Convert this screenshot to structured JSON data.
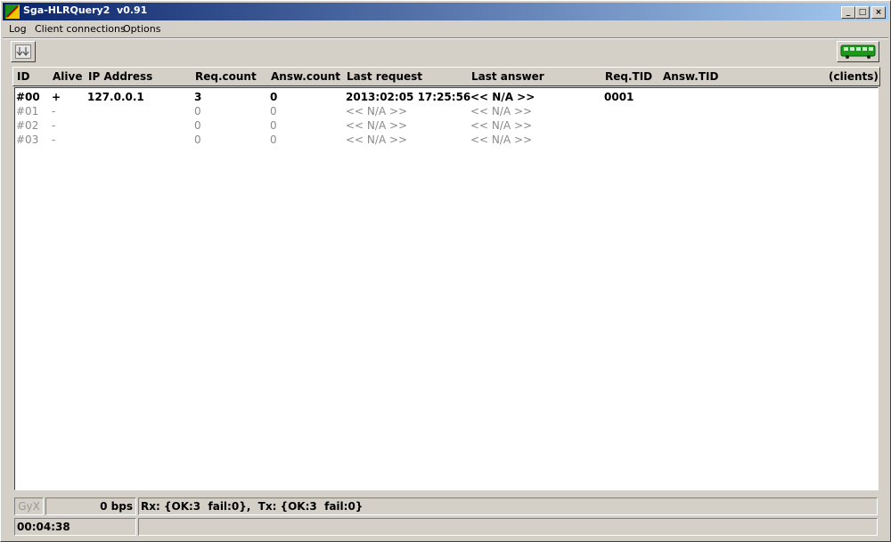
{
  "window": {
    "title": "Sga-HLRQuery2  v0.91"
  },
  "menu": [
    "Log",
    "Client connections",
    "Options"
  ],
  "columns": [
    "ID",
    "Alive",
    "IP Address",
    "Req.count",
    "Answ.count",
    "Last request",
    "Last answer",
    "Req.TID",
    "Answ.TID",
    "(clients)"
  ],
  "rows": [
    {
      "id": "#00",
      "alive": "+",
      "ip": "127.0.0.1",
      "req_count": "3",
      "answ_count": "0",
      "last_request": "2013:02:05 17:25:56",
      "last_answer": "<< N/A >>",
      "req_tid": "0001",
      "answ_tid": "",
      "active": true
    },
    {
      "id": "#01",
      "alive": "-",
      "ip": "",
      "req_count": "0",
      "answ_count": "0",
      "last_request": "<< N/A >>",
      "last_answer": "<< N/A >>",
      "req_tid": "",
      "answ_tid": "",
      "active": false
    },
    {
      "id": "#02",
      "alive": "-",
      "ip": "",
      "req_count": "0",
      "answ_count": "0",
      "last_request": "<< N/A >>",
      "last_answer": "<< N/A >>",
      "req_tid": "",
      "answ_tid": "",
      "active": false
    },
    {
      "id": "#03",
      "alive": "-",
      "ip": "",
      "req_count": "0",
      "answ_count": "0",
      "last_request": "<< N/A >>",
      "last_answer": "<< N/A >>",
      "req_tid": "",
      "answ_tid": "",
      "active": false
    }
  ],
  "status": {
    "logo": "GyX",
    "bps": "0 bps",
    "rxtx": "Rx: {OK:3  fail:0},  Tx: {OK:3  fail:0}",
    "uptime": "00:04:38",
    "message": ""
  },
  "icons": {
    "app": "app-icon",
    "toolbar": "auto-scroll-icon",
    "bus": "bus-icon"
  }
}
